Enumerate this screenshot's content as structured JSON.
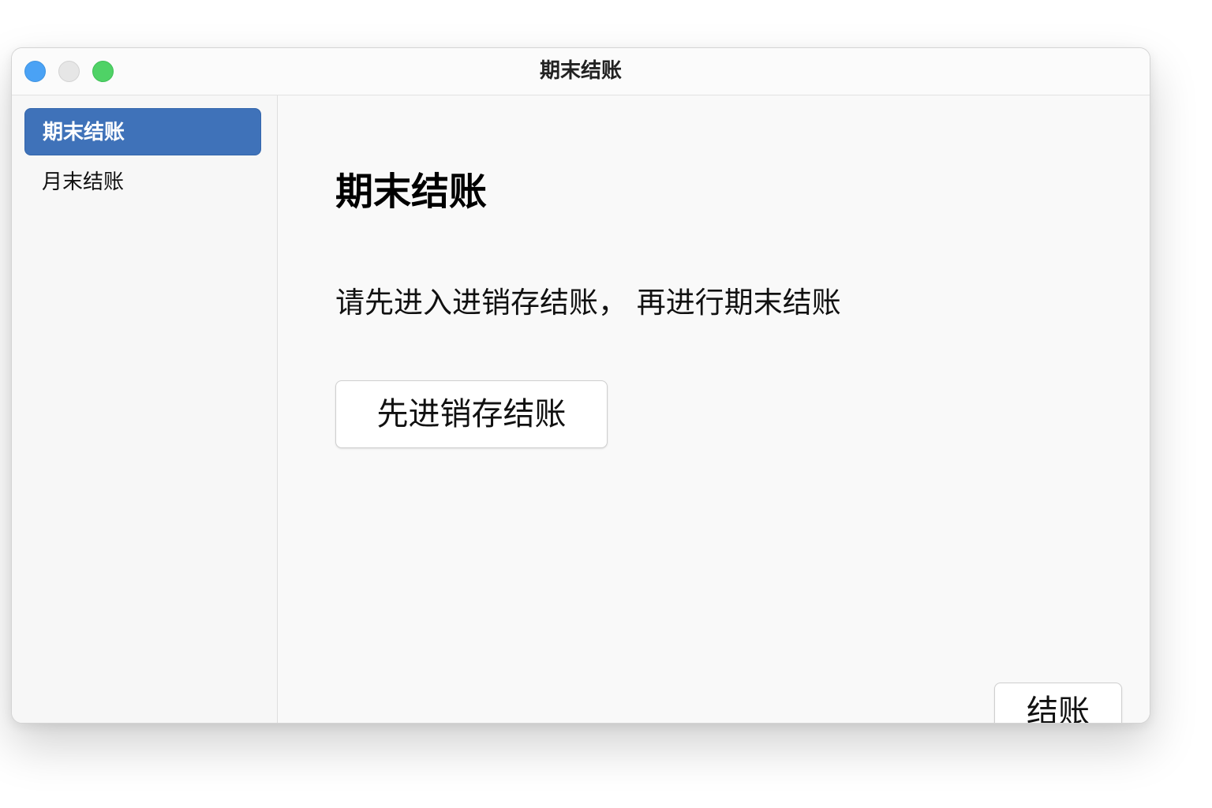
{
  "window": {
    "title": "期末结账",
    "controls": [
      "close",
      "minimize",
      "zoom"
    ],
    "control_colors": {
      "close": "#4aa2f5",
      "minimize": "#e6e6e6",
      "zoom": "#4fd266"
    }
  },
  "sidebar": {
    "items": [
      {
        "label": "期末结账",
        "selected": true
      },
      {
        "label": "月末结账",
        "selected": false
      }
    ],
    "selected_color": "#3f72b9"
  },
  "main": {
    "heading": "期末结账",
    "message": "请先进入进销存结账， 再进行期末结账",
    "fifo_button_label": "先进销存结账",
    "checkout_button_label": "结账"
  }
}
